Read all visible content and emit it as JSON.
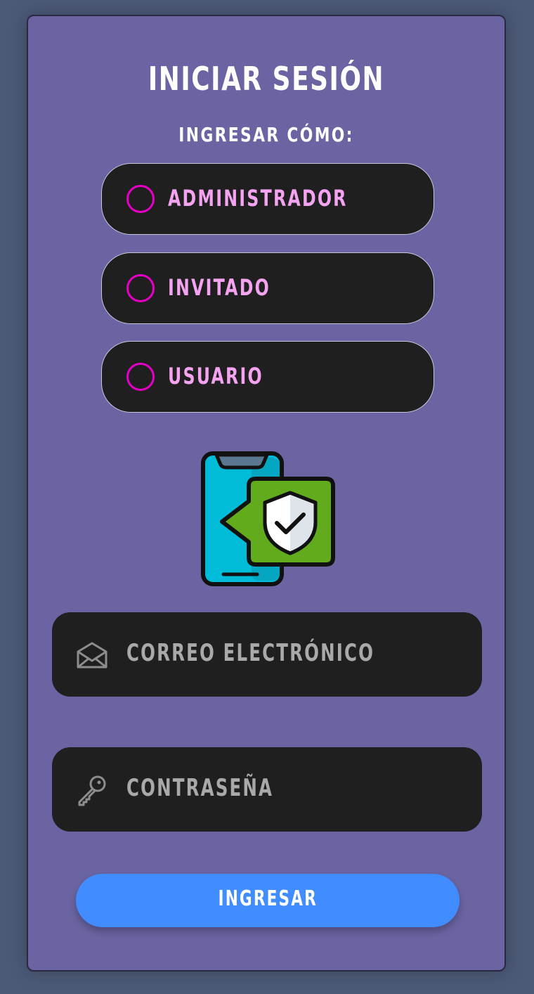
{
  "login": {
    "title": "INICIAR SESIÓN",
    "subtitle": "INGRESAR CÓMO:",
    "roles": [
      {
        "label": "ADMINISTRADOR",
        "selected": false
      },
      {
        "label": "INVITADO",
        "selected": false
      },
      {
        "label": "USUARIO",
        "selected": false
      }
    ],
    "email": {
      "placeholder": "CORREO ELECTRÓNICO",
      "value": "",
      "icon": "envelope-icon"
    },
    "password": {
      "placeholder": "CONTRASEÑA",
      "value": "",
      "icon": "key-icon"
    },
    "submit_label": "INGRESAR",
    "illustration_icon": "phone-shield-check-icon"
  },
  "colors": {
    "page_bg": "#4c5a77",
    "card_bg": "#6a64a2",
    "pill_bg": "#1f1f1f",
    "radio": "#e600c7",
    "role_text": "#f3a3ef",
    "button": "#418cff",
    "shield_green": "#62ab1c",
    "phone_blue": "#00bcd8"
  }
}
